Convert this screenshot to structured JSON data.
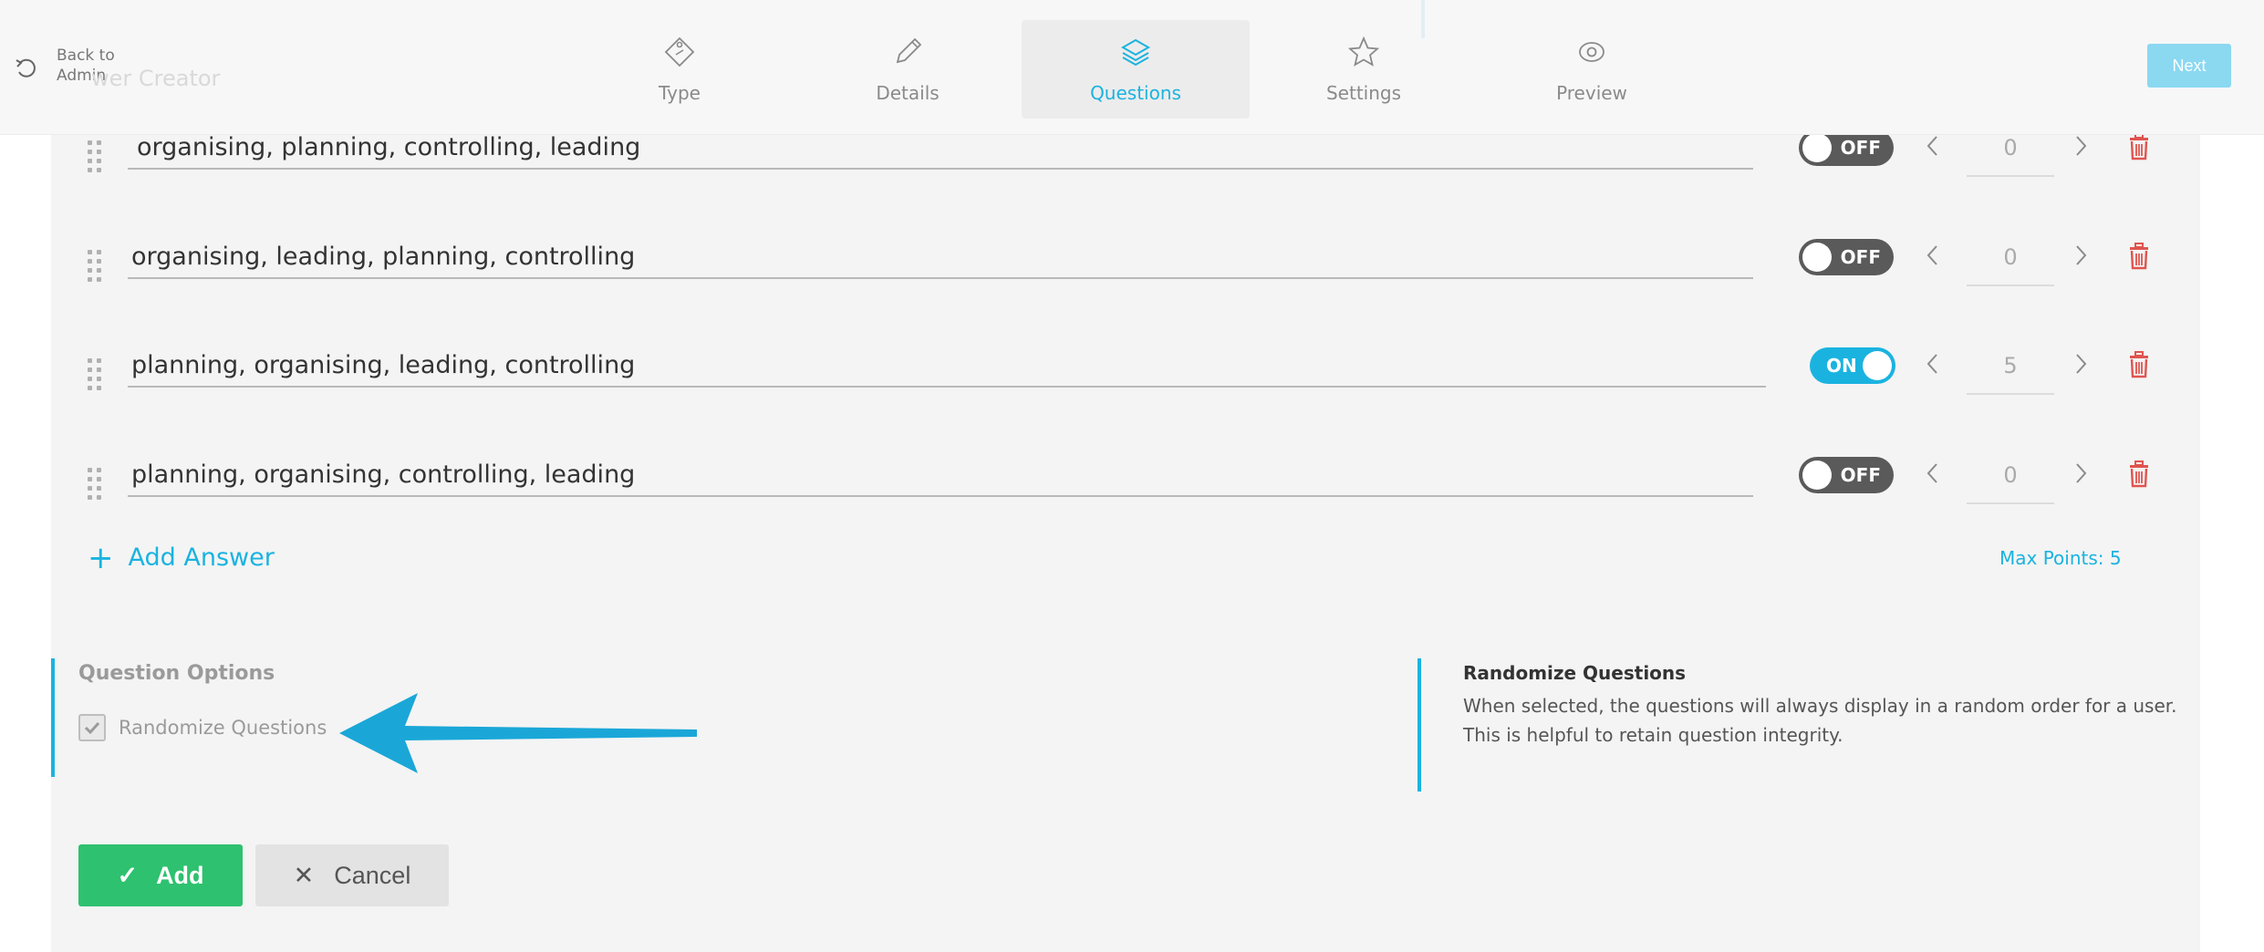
{
  "header": {
    "back_line1": "Back to",
    "back_line2": "Admin",
    "ghost_title": "wer Creator",
    "steps": [
      {
        "label": "Type",
        "icon": "tag-icon"
      },
      {
        "label": "Details",
        "icon": "pencil-icon"
      },
      {
        "label": "Questions",
        "icon": "layers-icon",
        "active": true
      },
      {
        "label": "Settings",
        "icon": "star-icon"
      },
      {
        "label": "Preview",
        "icon": "eye-icon"
      }
    ],
    "next_label": "Next"
  },
  "answers": [
    {
      "text": "organising, planning, controlling, leading",
      "correct": false,
      "toggle": "OFF",
      "points": "0"
    },
    {
      "text": "organising, leading, planning, controlling",
      "correct": false,
      "toggle": "OFF",
      "points": "0"
    },
    {
      "text": "planning, organising, leading, controlling",
      "correct": true,
      "toggle": "ON",
      "points": "5"
    },
    {
      "text": "planning, organising, controlling, leading",
      "correct": false,
      "toggle": "OFF",
      "points": "0"
    }
  ],
  "add_answer_label": "Add Answer",
  "max_points": "Max Points: 5",
  "question_options": {
    "title": "Question Options",
    "randomize_label": "Randomize Questions",
    "randomize_checked": true
  },
  "info": {
    "title": "Randomize Questions",
    "text": "When selected, the questions will always display in a random order for a user. This is helpful to retain question integrity."
  },
  "actions": {
    "add_label": "Add",
    "cancel_label": "Cancel"
  },
  "colors": {
    "accent": "#1ab3e0",
    "success": "#2ec16f",
    "danger": "#e0544f",
    "toggle_off": "#5a5a5a"
  }
}
